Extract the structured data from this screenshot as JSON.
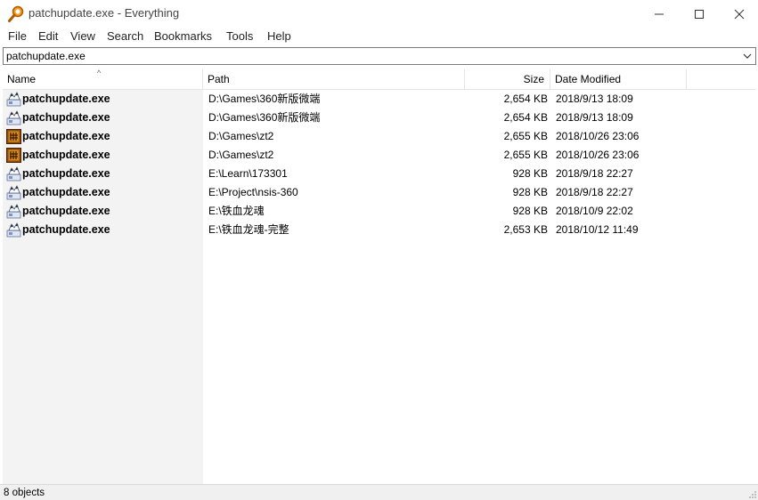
{
  "window": {
    "title": "patchupdate.exe - Everything",
    "app_icon": "magnifier-icon",
    "controls": [
      "minimize-icon",
      "maximize-icon",
      "close-icon"
    ]
  },
  "menu": [
    "File",
    "Edit",
    "View",
    "Search",
    "Bookmarks",
    "Tools",
    "Help"
  ],
  "search": {
    "value": "patchupdate.exe",
    "dropdown_icon": "chevron-down-icon"
  },
  "columns": {
    "name": "Name",
    "path": "Path",
    "size": "Size",
    "date": "Date Modified",
    "sort": "Name ascending"
  },
  "rows": [
    {
      "icon": "installer-icon",
      "name": "patchupdate.exe",
      "path": "D:\\Games\\360新版微端",
      "size": "2,654 KB",
      "date": "2018/9/13 18:09"
    },
    {
      "icon": "installer-icon",
      "name": "patchupdate.exe",
      "path": "D:\\Games\\360新版微端",
      "size": "2,654 KB",
      "date": "2018/9/13 18:09"
    },
    {
      "icon": "game-app-icon",
      "name": "patchupdate.exe",
      "path": "D:\\Games\\zt2",
      "size": "2,655 KB",
      "date": "2018/10/26 23:06"
    },
    {
      "icon": "game-app-icon",
      "name": "patchupdate.exe",
      "path": "D:\\Games\\zt2",
      "size": "2,655 KB",
      "date": "2018/10/26 23:06"
    },
    {
      "icon": "installer-icon",
      "name": "patchupdate.exe",
      "path": "E:\\Learn\\173301",
      "size": "928 KB",
      "date": "2018/9/18 22:27"
    },
    {
      "icon": "installer-icon",
      "name": "patchupdate.exe",
      "path": "E:\\Project\\nsis-360",
      "size": "928 KB",
      "date": "2018/9/18 22:27"
    },
    {
      "icon": "installer-icon",
      "name": "patchupdate.exe",
      "path": "E:\\铁血龙魂",
      "size": "928 KB",
      "date": "2018/10/9 22:02"
    },
    {
      "icon": "installer-icon",
      "name": "patchupdate.exe",
      "path": "E:\\铁血龙魂-完整",
      "size": "2,653 KB",
      "date": "2018/10/12 11:49"
    }
  ],
  "status": "8 objects"
}
